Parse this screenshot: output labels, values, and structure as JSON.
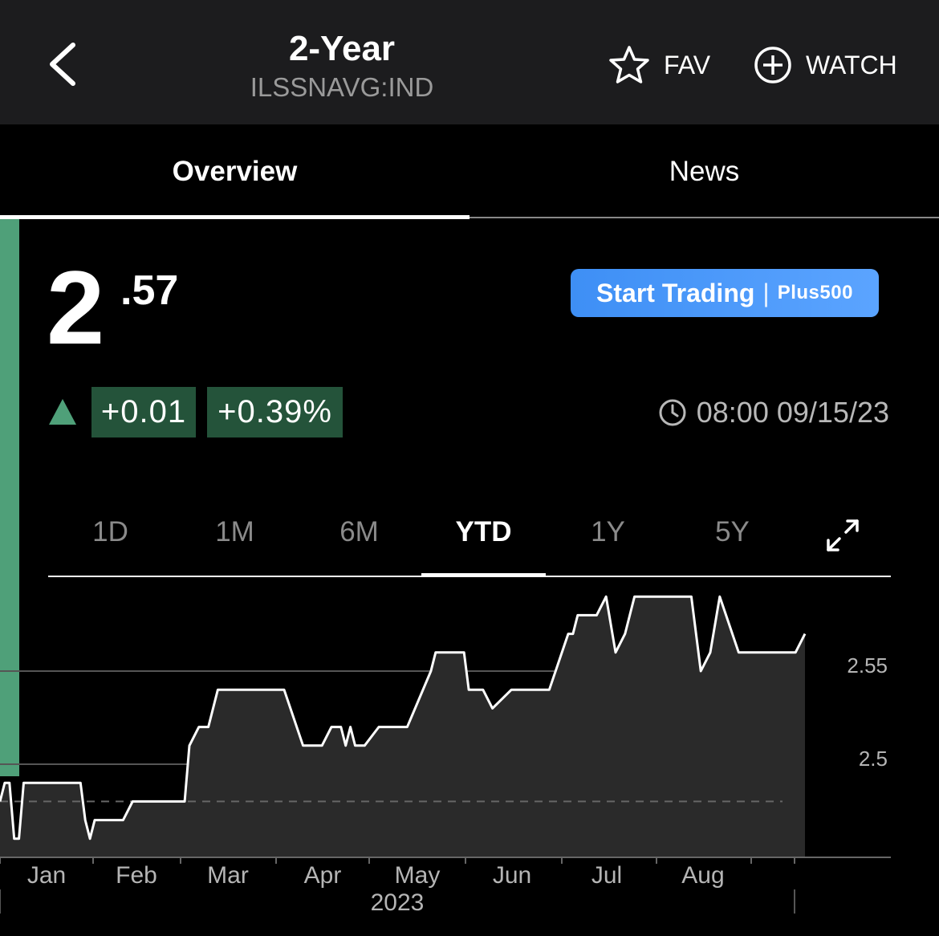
{
  "header": {
    "title": "2-Year",
    "ticker": "ILSSNAVG:IND",
    "fav_label": "FAV",
    "watch_label": "WATCH"
  },
  "tabs": [
    {
      "label": "Overview",
      "active": true
    },
    {
      "label": "News",
      "active": false
    }
  ],
  "quote": {
    "price_int": "2",
    "price_dec": ".57",
    "change": "+0.01",
    "change_pct": "+0.39%",
    "timestamp": "08:00 09/15/23",
    "direction": "up"
  },
  "promo": {
    "label": "Start Trading",
    "separator": "|",
    "brand": "Plus500"
  },
  "ranges": {
    "options": [
      "1D",
      "1M",
      "6M",
      "YTD",
      "1Y",
      "5Y"
    ],
    "selected": "YTD"
  },
  "colors": {
    "accent_green": "#4fa079",
    "change_bg": "#24533a",
    "cta_blue": "#3e8ff5"
  },
  "chart_data": {
    "type": "area",
    "title": "",
    "xlabel": "2023",
    "ylabel": "",
    "y_ticks": [
      2.55,
      2.5
    ],
    "y_tick_labels": [
      "2.55",
      "2.5"
    ],
    "ylim": [
      2.435,
      2.6
    ],
    "x_tick_labels": [
      "Jan",
      "Feb",
      "Mar",
      "Apr",
      "May",
      "Jun",
      "Jul",
      "Aug"
    ],
    "year_label": "2023",
    "previous_close": 2.48,
    "grid": true,
    "series": [
      {
        "x": [
          0,
          0.05,
          0.1,
          0.15,
          0.2,
          0.25,
          0.3,
          0.36,
          0.55,
          0.85,
          0.9,
          0.95,
          1.0,
          1.05,
          1.3,
          1.4,
          1.6,
          1.75,
          1.95,
          2.0,
          2.1,
          2.2,
          2.3,
          2.6,
          2.8,
          3.0,
          3.2,
          3.3,
          3.4,
          3.5,
          3.55,
          3.6,
          3.65,
          3.7,
          3.75,
          3.85,
          4.0,
          4.2,
          4.3,
          4.55,
          4.6,
          4.8,
          4.9,
          4.95,
          5.1,
          5.2,
          5.4,
          5.5,
          5.6,
          5.8,
          6.0,
          6.05,
          6.1,
          6.3,
          6.4,
          6.5,
          6.6,
          6.7,
          7.0,
          7.3,
          7.4,
          7.5,
          7.6,
          7.8,
          8.0,
          8.2,
          8.25,
          8.4,
          8.5
        ],
        "values": [
          2.48,
          2.49,
          2.49,
          2.46,
          2.46,
          2.49,
          2.49,
          2.49,
          2.49,
          2.49,
          2.47,
          2.46,
          2.47,
          2.47,
          2.47,
          2.48,
          2.48,
          2.48,
          2.48,
          2.51,
          2.52,
          2.52,
          2.54,
          2.54,
          2.54,
          2.54,
          2.51,
          2.51,
          2.51,
          2.52,
          2.52,
          2.52,
          2.51,
          2.52,
          2.51,
          2.51,
          2.52,
          2.52,
          2.52,
          2.55,
          2.56,
          2.56,
          2.56,
          2.54,
          2.54,
          2.53,
          2.54,
          2.54,
          2.54,
          2.54,
          2.57,
          2.57,
          2.58,
          2.58,
          2.59,
          2.56,
          2.57,
          2.59,
          2.59,
          2.59,
          2.55,
          2.56,
          2.59,
          2.56,
          2.56,
          2.56,
          2.56,
          2.56,
          2.57
        ]
      }
    ]
  }
}
